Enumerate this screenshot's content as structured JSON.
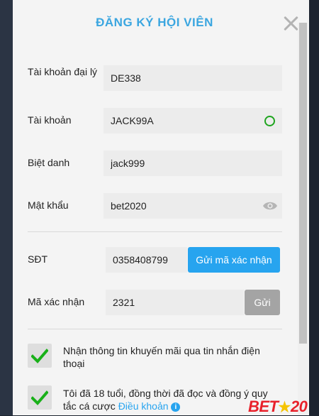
{
  "modal": {
    "title": "ĐĂNG KÝ HỘI VIÊN",
    "title_color": "#3ba6e0"
  },
  "fields": {
    "agent_account": {
      "label": "Tài khoản đại lý",
      "value": "DE338"
    },
    "account": {
      "label": "Tài khoản",
      "value": "JACK99A",
      "status_icon": "valid-circle-icon",
      "status_color": "#1fa51f"
    },
    "nickname": {
      "label": "Biệt danh",
      "value": "jack999"
    },
    "password": {
      "label": "Mật khẩu",
      "value": "bet2020",
      "toggle_icon": "eye-icon"
    },
    "phone": {
      "label": "SĐT",
      "value": "0358408799",
      "button_label": "Gửi mã xác nhận"
    },
    "verification": {
      "label": "Mã xác nhận",
      "value": "2321",
      "button_label": "Gửi"
    }
  },
  "checks": {
    "promo": {
      "text": "Nhận thông tin khuyến mãi qua tin nhắn điện thoại",
      "checked": true
    },
    "terms": {
      "text_before": "Tôi đã 18 tuổi, đồng thời đã đọc và đồng ý quy tắc cá cược ",
      "link": "Điều khoản",
      "info_icon": "i",
      "checked": true
    }
  },
  "logo": {
    "prefix": "BET",
    "star": "★",
    "suffix": "20"
  },
  "colors": {
    "accent": "#27a4ef",
    "check_green": "#19b019",
    "logo_red": "#e8212b"
  }
}
